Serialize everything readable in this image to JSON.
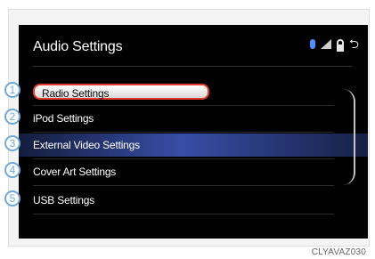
{
  "screen": {
    "title": "Audio Settings",
    "status_icons": [
      "bluetooth-icon",
      "signal-strength-icon",
      "lock-icon",
      "back-icon"
    ],
    "back_glyph": "⮌"
  },
  "menu": {
    "items": [
      {
        "label": "Radio Settings",
        "selected": true
      },
      {
        "label": "iPod Settings",
        "selected": false
      },
      {
        "label": "External Video Settings",
        "selected": false
      },
      {
        "label": "Cover Art Settings",
        "selected": false
      },
      {
        "label": "USB Settings",
        "selected": false
      }
    ],
    "highlight_color": "#3a52af",
    "selection_border_color": "#e53b2e"
  },
  "callouts": [
    "1",
    "2",
    "3",
    "4",
    "5"
  ],
  "caption": "CLYAVAZ030"
}
